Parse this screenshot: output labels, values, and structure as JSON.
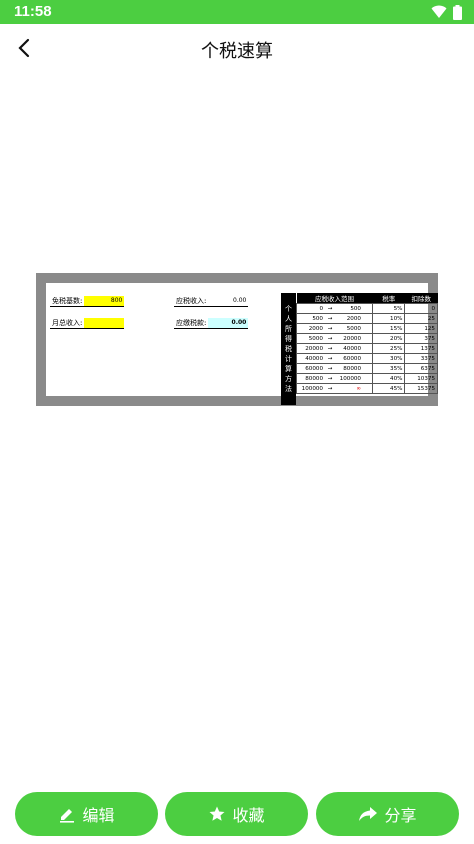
{
  "status": {
    "time": "11:58"
  },
  "header": {
    "title": "个税速算"
  },
  "calc": {
    "exempt_label": "免税基数:",
    "exempt_value": "800",
    "income_label": "月总收入:",
    "income_value": "",
    "taxable_label": "应税收入:",
    "taxable_value": "0.00",
    "payable_label": "应缴税款:",
    "payable_value": "0.00"
  },
  "table": {
    "side_label": [
      "个",
      "人",
      "所",
      "得",
      "税",
      "计",
      "算",
      "方",
      "法"
    ],
    "headers": [
      "应税收入范围",
      "税率",
      "扣除数"
    ],
    "rows": [
      {
        "from": "0",
        "to": "500",
        "rate": "5%",
        "deduct": "0"
      },
      {
        "from": "500",
        "to": "2000",
        "rate": "10%",
        "deduct": "25"
      },
      {
        "from": "2000",
        "to": "5000",
        "rate": "15%",
        "deduct": "125"
      },
      {
        "from": "5000",
        "to": "20000",
        "rate": "20%",
        "deduct": "375"
      },
      {
        "from": "20000",
        "to": "40000",
        "rate": "25%",
        "deduct": "1375"
      },
      {
        "from": "40000",
        "to": "60000",
        "rate": "30%",
        "deduct": "3375"
      },
      {
        "from": "60000",
        "to": "80000",
        "rate": "35%",
        "deduct": "6375"
      },
      {
        "from": "80000",
        "to": "100000",
        "rate": "40%",
        "deduct": "10375"
      },
      {
        "from": "100000",
        "to": "∞",
        "rate": "45%",
        "deduct": "15375"
      }
    ],
    "arrow": "→"
  },
  "actions": {
    "edit_label": "编辑",
    "favorite_label": "收藏",
    "share_label": "分享"
  },
  "colors": {
    "accent": "#4cce41",
    "highlight_yellow": "#ffff00",
    "highlight_cyan": "#ccffff"
  }
}
